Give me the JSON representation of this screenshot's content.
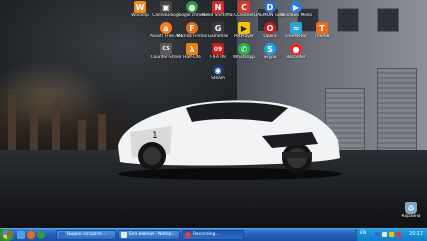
{
  "desktop_icons": [
    {
      "label": "Winamp",
      "color": "#f18a1f",
      "glyph": "W"
    },
    {
      "label": "CamStudio 7",
      "color": "#444444",
      "glyph": "▣"
    },
    {
      "label": "google chrome",
      "color": "#2f9b3e",
      "glyph": "●"
    },
    {
      "label": "Need Shift(Mail)",
      "color": "#ce2b2b",
      "glyph": "N"
    },
    {
      "label": "CCleaner",
      "color": "#d23b2a",
      "glyph": "C"
    },
    {
      "label": "DAEMON Tools Lite",
      "color": "#2a6fd0",
      "glyph": "D"
    },
    {
      "label": "Windows Media Player",
      "color": "#2b7fd8",
      "glyph": "▶"
    },
    {
      "label": "Avast! Free Antivirus",
      "color": "#ff7a1a",
      "glyph": "a"
    },
    {
      "label": "Mozilla Firefox",
      "color": "#e06b1a",
      "glyph": "F"
    },
    {
      "label": "GameRail",
      "color": "#3b3b3b",
      "glyph": "G"
    },
    {
      "label": "PotPlayer",
      "color": "#f4c20d",
      "glyph": "▶"
    },
    {
      "label": "Opera",
      "color": "#cc1b1b",
      "glyph": "O"
    },
    {
      "label": "FreeMeter",
      "color": "#2ea5d8",
      "glyph": "≈"
    },
    {
      "label": "TheAIB",
      "color": "#e86a1a",
      "glyph": "T"
    },
    {
      "label": "Counter-Strike",
      "color": "#5a5a5a",
      "glyph": "CS"
    },
    {
      "label": "Half-Life",
      "color": "#ef7b12",
      "glyph": "λ"
    },
    {
      "label": "FIFA 09",
      "color": "#c81b1b",
      "glyph": "09"
    },
    {
      "label": "WhatsApp",
      "color": "#25b34a",
      "glyph": "✆"
    },
    {
      "label": "Skype",
      "color": "#1ea0e0",
      "glyph": "S"
    },
    {
      "label": "Recorder",
      "color": "#ea2b2b",
      "glyph": "●"
    },
    {
      "label": "Steam",
      "color": "#1b3a6b",
      "glyph": "◉"
    }
  ],
  "recycle_bin": {
    "label": "Корзина"
  },
  "taskbar": {
    "tasks": [
      {
        "label": "Видео создате...",
        "color": "#2b6fd6",
        "active": false
      },
      {
        "label": "Без имени - Notep...",
        "color": "#e8e8e8",
        "active": false
      },
      {
        "label": "Recording...",
        "color": "#e23b3b",
        "active": true
      }
    ],
    "language": "EN",
    "clock": "20:17"
  }
}
